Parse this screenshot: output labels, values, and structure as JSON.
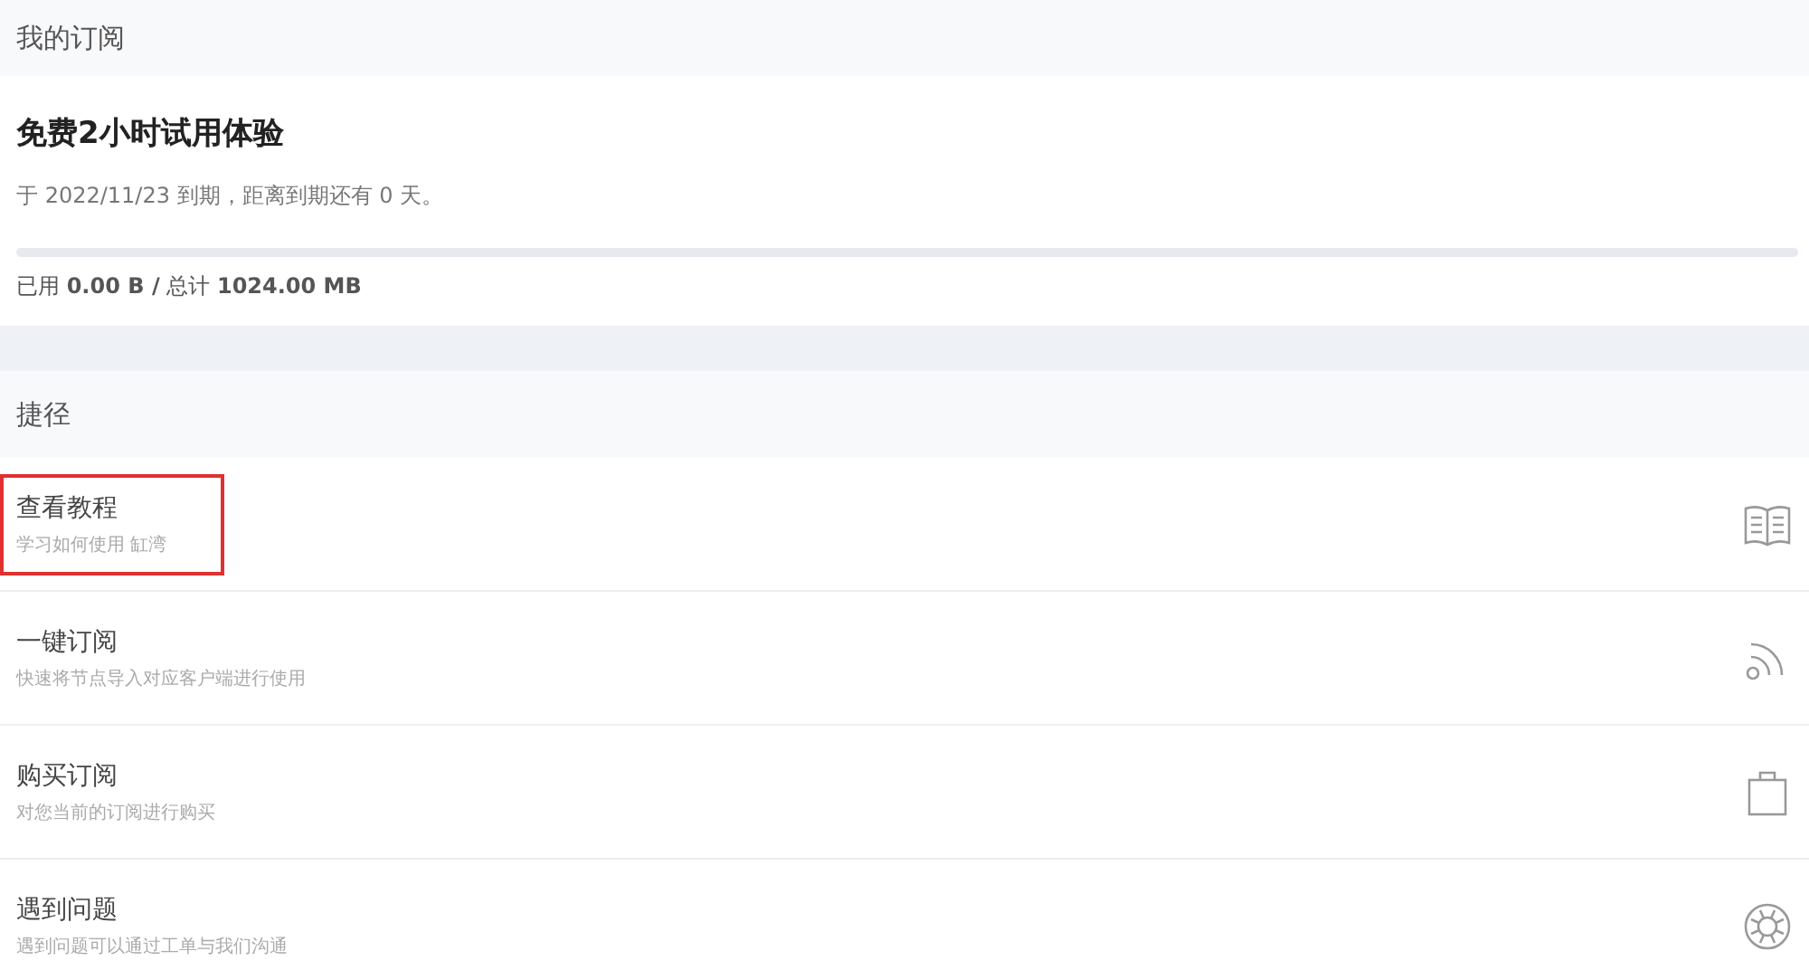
{
  "subscription": {
    "header": "我的订阅",
    "plan": "免费2小时试用体验",
    "expiry": "于 2022/11/23 到期，距离到期还有 0 天。",
    "usage": {
      "level": 0,
      "text": "已用 **0.00 B /** 总计 **1024.00 MB**"
    }
  },
  "shortcuts": {
    "header": "捷径",
    "items": [
      {
        "title": "查看教程",
        "subtitle": "学习如何使用 缸湾",
        "highlighted": true
      },
      {
        "title": "一键订阅",
        "subtitle": "快速将节点导入对应客户端进行使用",
        "highlighted": false
      },
      {
        "title": "购买订阅",
        "subtitle": "对您当前的订阅进行购买",
        "highlighted": false
      },
      {
        "title": "遇到问题",
        "subtitle": "遇到问题可以通过工单与我们沟通",
        "highlighted": false
      }
    ]
  }
}
